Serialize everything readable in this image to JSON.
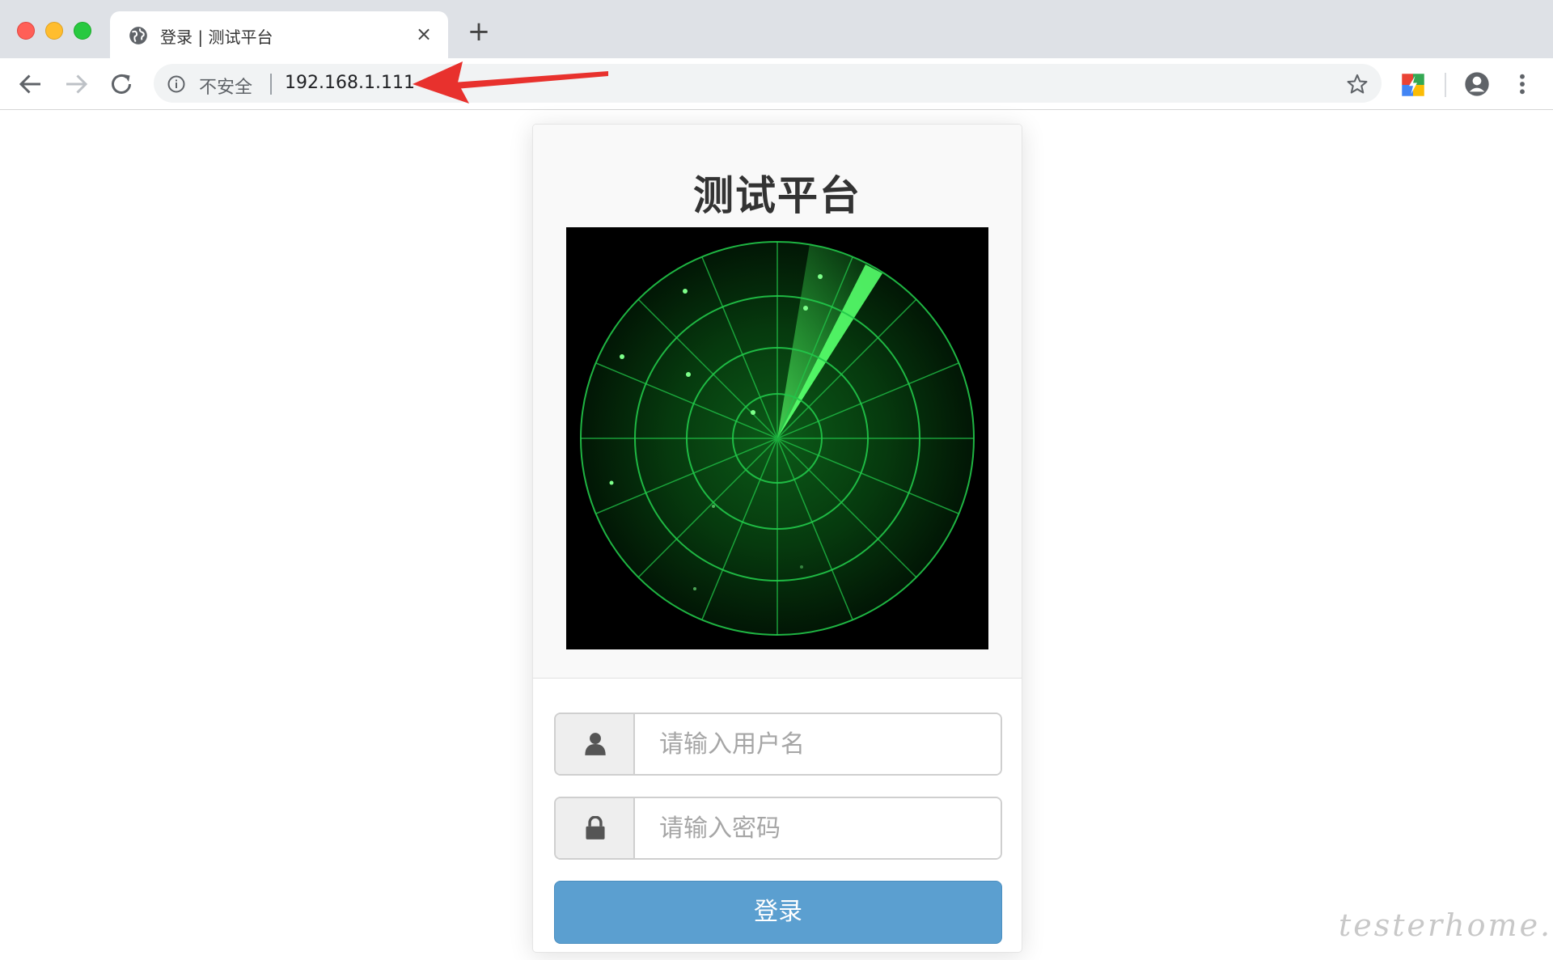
{
  "browser": {
    "tab_title": "登录 | 测试平台",
    "close_symbol": "×",
    "new_tab_symbol": "+",
    "security_label": "不安全",
    "url": "192.168.1.111"
  },
  "page": {
    "title": "测试平台",
    "username_placeholder": "请输入用户名",
    "password_placeholder": "请输入密码",
    "login_label": "登录"
  },
  "watermark": "testerhome.com",
  "colors": {
    "radar_green": "#22c84a",
    "login_button": "#5b9fd0",
    "annotation_arrow": "#e8312d"
  },
  "icons": [
    "globe-icon",
    "close-icon",
    "plus-icon",
    "back-icon",
    "forward-icon",
    "reload-icon",
    "info-icon",
    "star-icon",
    "extension-icon",
    "profile-icon",
    "menu-icon",
    "user-icon",
    "lock-icon"
  ]
}
